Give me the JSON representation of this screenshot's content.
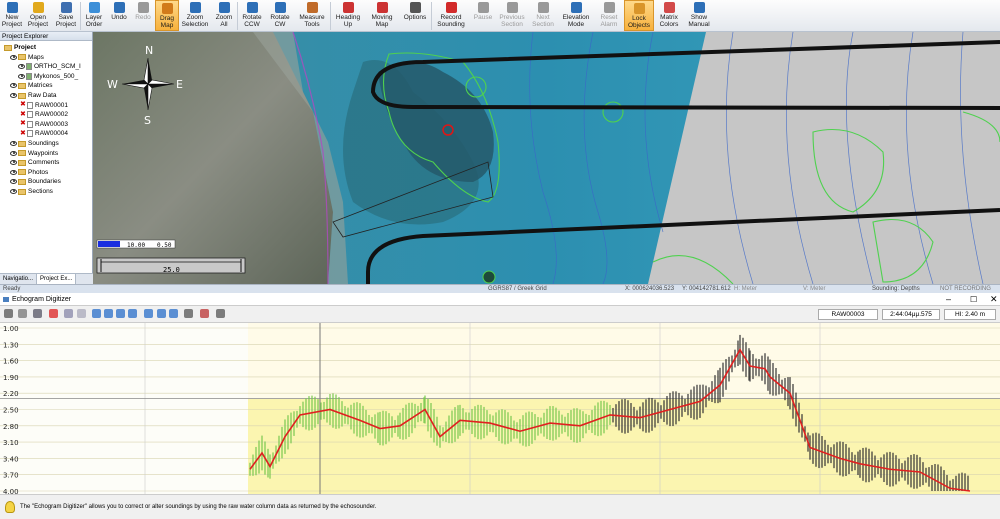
{
  "ribbon": {
    "buttons": [
      {
        "id": "new-project",
        "label": "New\nProject",
        "icon": "new-doc-icon",
        "color": "#2d6fb7",
        "w": 24
      },
      {
        "id": "open-project",
        "label": "Open\nProject",
        "icon": "folder-open-icon",
        "color": "#e1a91d",
        "w": 28
      },
      {
        "id": "save-project",
        "label": "Save\nProject",
        "icon": "floppy-icon",
        "color": "#3e6fb0",
        "w": 28
      },
      {
        "sep": true
      },
      {
        "id": "layer-order",
        "label": "Layer\nOrder",
        "icon": "layers-icon",
        "color": "#3c8fd8",
        "w": 26
      },
      {
        "id": "undo",
        "label": "Undo",
        "icon": "undo-icon",
        "color": "#2d6fb7",
        "w": 24
      },
      {
        "id": "redo",
        "label": "Redo",
        "icon": "redo-icon",
        "color": "#999999",
        "w": 24,
        "disabled": true
      },
      {
        "id": "drag-map",
        "label": "Drag\nMap",
        "icon": "hand-icon",
        "color": "#d17a1a",
        "w": 24,
        "active": true
      },
      {
        "id": "zoom-selection",
        "label": "Zoom\nSelection",
        "icon": "zoom-rect-icon",
        "color": "#2d6fb7",
        "w": 32
      },
      {
        "id": "zoom-all",
        "label": "Zoom\nAll",
        "icon": "zoom-all-icon",
        "color": "#2d6fb7",
        "w": 26
      },
      {
        "sep": true
      },
      {
        "id": "rotate-ccw",
        "label": "Rotate\nCCW",
        "icon": "rotate-ccw-icon",
        "color": "#2d6fb7",
        "w": 28
      },
      {
        "id": "rotate-cw",
        "label": "Rotate\nCW",
        "icon": "rotate-cw-icon",
        "color": "#2d6fb7",
        "w": 28
      },
      {
        "id": "measure-tools",
        "label": "Measure\nTools",
        "icon": "ruler-icon",
        "color": "#c06b2a",
        "w": 36
      },
      {
        "sep": true
      },
      {
        "id": "heading-up",
        "label": "Heading\nUp",
        "icon": "heading-up-icon",
        "color": "#cc3333",
        "w": 34
      },
      {
        "id": "moving-map",
        "label": "Moving\nMap",
        "icon": "moving-map-icon",
        "color": "#cc3333",
        "w": 34
      },
      {
        "id": "options",
        "label": "Options",
        "icon": "options-icon",
        "color": "#555555",
        "w": 32
      },
      {
        "sep": true
      },
      {
        "id": "record-sounding",
        "label": "Record\nSounding",
        "icon": "record-icon",
        "color": "#d22a2a",
        "w": 38
      },
      {
        "id": "pause",
        "label": "Pause",
        "icon": "pause-icon",
        "color": "#999999",
        "w": 26,
        "disabled": true
      },
      {
        "id": "previous-section",
        "label": "Previous\nSection",
        "icon": "prev-section-icon",
        "color": "#999999",
        "w": 32,
        "disabled": true
      },
      {
        "id": "next-section",
        "label": "Next\nSection",
        "icon": "next-section-icon",
        "color": "#999999",
        "w": 30,
        "disabled": true
      },
      {
        "id": "elevation-mode",
        "label": "Elevation\nMode",
        "icon": "elevation-icon",
        "color": "#2d6fb7",
        "w": 36
      },
      {
        "id": "reset-alarm",
        "label": "Reset\nAlarm",
        "icon": "alarm-icon",
        "color": "#999999",
        "w": 30,
        "disabled": true
      },
      {
        "id": "lock-objects",
        "label": "Lock\nObjects",
        "icon": "lock-icon",
        "color": "#d9952a",
        "w": 30,
        "active": true
      },
      {
        "id": "matrix-colors",
        "label": "Matrix\nColors",
        "icon": "color-wheel-icon",
        "color": "#d24a4a",
        "w": 30
      },
      {
        "id": "show-manual",
        "label": "Show\nManual",
        "icon": "manual-icon",
        "color": "#2d6fb7",
        "w": 30
      }
    ]
  },
  "sidebar": {
    "title": "Project Explorer",
    "items": [
      {
        "label": "Project",
        "type": "root"
      },
      {
        "label": "Maps",
        "type": "folder"
      },
      {
        "label": "ORTHO_SCM_I",
        "type": "map"
      },
      {
        "label": "Mykonos_500_",
        "type": "map"
      },
      {
        "label": "Matrices",
        "type": "folder"
      },
      {
        "label": "Raw Data",
        "type": "folder"
      },
      {
        "label": "RAW00001",
        "type": "raw"
      },
      {
        "label": "RAW00002",
        "type": "raw"
      },
      {
        "label": "RAW00003",
        "type": "raw"
      },
      {
        "label": "RAW00004",
        "type": "raw"
      },
      {
        "label": "Soundings",
        "type": "folder"
      },
      {
        "label": "Waypoints",
        "type": "folder"
      },
      {
        "label": "Comments",
        "type": "folder"
      },
      {
        "label": "Photos",
        "type": "folder"
      },
      {
        "label": "Boundaries",
        "type": "folder"
      },
      {
        "label": "Sections",
        "type": "folder"
      }
    ],
    "tabs": [
      "Navigatio...",
      "Project Ex..."
    ]
  },
  "map": {
    "compass": {
      "n": "N",
      "s": "S",
      "e": "E",
      "w": "W"
    },
    "scale_top": [
      "10.00",
      "0.50"
    ],
    "scale_bottom": "25.0"
  },
  "status": {
    "ready": "Ready",
    "grid": "GGRS87 / Greek Grid",
    "x": "X: 000624036.523",
    "y": "Y: 004142781.612",
    "h": "H: Meter",
    "v": "V: Meter",
    "sounding": "Sounding: Depths",
    "recording": "NOT RECORDING"
  },
  "echogram": {
    "title": "Echogram Digitizer",
    "file": "RAW00003",
    "time": "2:44:04μμ.575",
    "hi": "HI: 2.40 m"
  },
  "help": "The \"Echogram Digitizer\" allows you to correct or alter soundings by using the raw water column data as returned by the echosounder.",
  "chart_data": {
    "type": "line",
    "y_ticks": [
      "1.00",
      "1.30",
      "1.60",
      "1.90",
      "2.20",
      "2.50",
      "2.80",
      "3.10",
      "3.40",
      "3.70",
      "4.00"
    ],
    "ylim": [
      1.0,
      4.0
    ],
    "series": [
      {
        "color": "#e02020",
        "x": [
          0,
          12,
          20,
          35,
          50,
          80,
          110,
          130,
          150,
          175,
          190,
          210,
          240,
          270,
          300,
          330,
          360,
          390,
          420,
          450,
          470,
          490,
          500,
          515,
          520,
          540,
          560,
          590,
          610,
          640,
          670,
          700,
          720
        ],
        "y": [
          3.6,
          3.3,
          3.55,
          3.0,
          2.6,
          2.5,
          2.7,
          2.85,
          2.8,
          2.5,
          3.0,
          2.7,
          2.75,
          2.9,
          2.75,
          2.8,
          2.6,
          2.65,
          2.5,
          2.35,
          2.05,
          1.4,
          1.7,
          1.75,
          1.9,
          2.2,
          3.2,
          3.4,
          3.5,
          3.6,
          3.65,
          3.95,
          4.0
        ]
      }
    ],
    "green_color": "#79c84f",
    "dark_color": "#333333"
  }
}
